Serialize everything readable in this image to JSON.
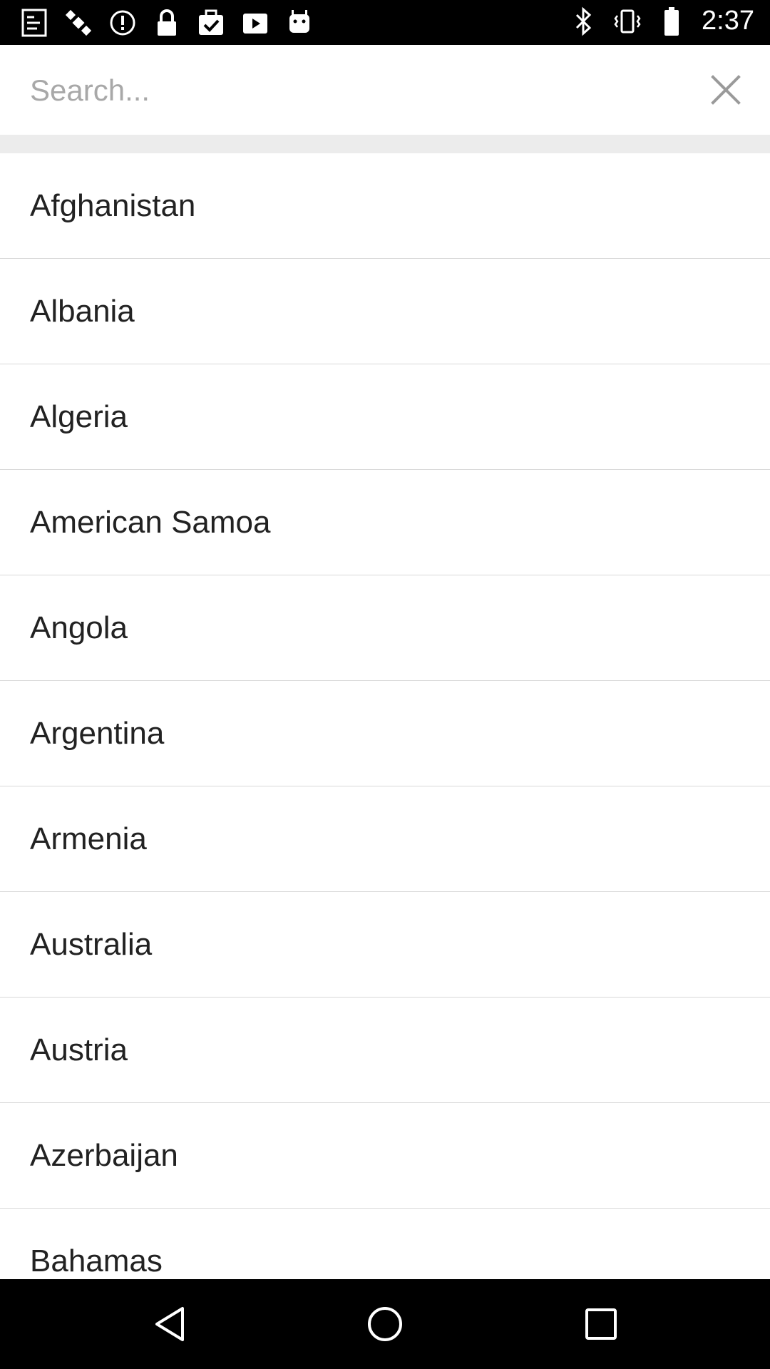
{
  "status_bar": {
    "time": "2:37",
    "left_icons": [
      "fake-gps-icon",
      "satellite-icon",
      "alert-icon",
      "lock-icon",
      "task-icon",
      "video-icon",
      "android-icon"
    ],
    "right_icons": [
      "bluetooth-icon",
      "vibrate-icon",
      "battery-icon"
    ]
  },
  "search": {
    "placeholder": "Search...",
    "value": ""
  },
  "countries": [
    "Afghanistan",
    "Albania",
    "Algeria",
    "American Samoa",
    "Angola",
    "Argentina",
    "Armenia",
    "Australia",
    "Austria",
    "Azerbaijan",
    "Bahamas"
  ],
  "colors": {
    "status_bar": "#000000",
    "background": "#ffffff",
    "divider": "#d9d9d9",
    "text": "#222222",
    "placeholder": "#a8a8a8"
  }
}
